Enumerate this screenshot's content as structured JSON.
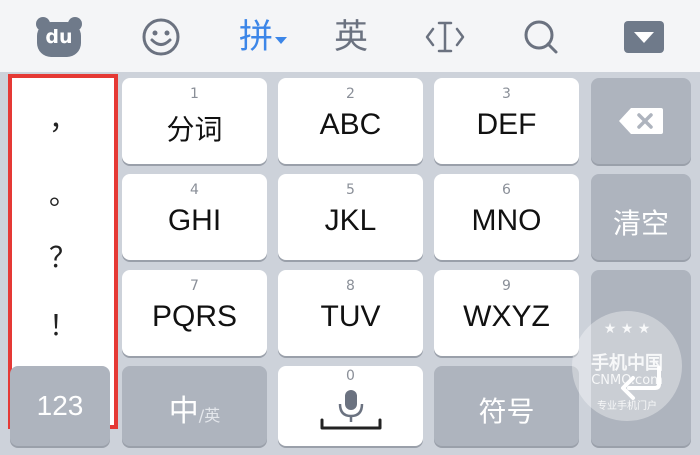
{
  "toolbar": {
    "du_label": "du",
    "pinyin_label": "拼",
    "english_label": "英"
  },
  "punctuation": [
    "，",
    "。",
    "？",
    "！"
  ],
  "keys": {
    "k1": {
      "num": "1",
      "label": "分词"
    },
    "k2": {
      "num": "2",
      "label": "ABC"
    },
    "k3": {
      "num": "3",
      "label": "DEF"
    },
    "k4": {
      "num": "4",
      "label": "GHI"
    },
    "k5": {
      "num": "5",
      "label": "JKL"
    },
    "k6": {
      "num": "6",
      "label": "MNO"
    },
    "k7": {
      "num": "7",
      "label": "PQRS"
    },
    "k8": {
      "num": "8",
      "label": "TUV"
    },
    "k9": {
      "num": "9",
      "label": "WXYZ"
    },
    "k0": {
      "num": "0"
    }
  },
  "side": {
    "clear_label": "清空"
  },
  "bottom": {
    "num_label": "123",
    "zh_label": "中",
    "en_small_label": "/英",
    "symbol_label": "符号"
  },
  "watermark": {
    "cn": "手机中国",
    "en": "CNMO.com",
    "tagline": "专业手机门户"
  },
  "colors": {
    "accent": "#3c86e8",
    "highlight_border": "#e53935"
  }
}
